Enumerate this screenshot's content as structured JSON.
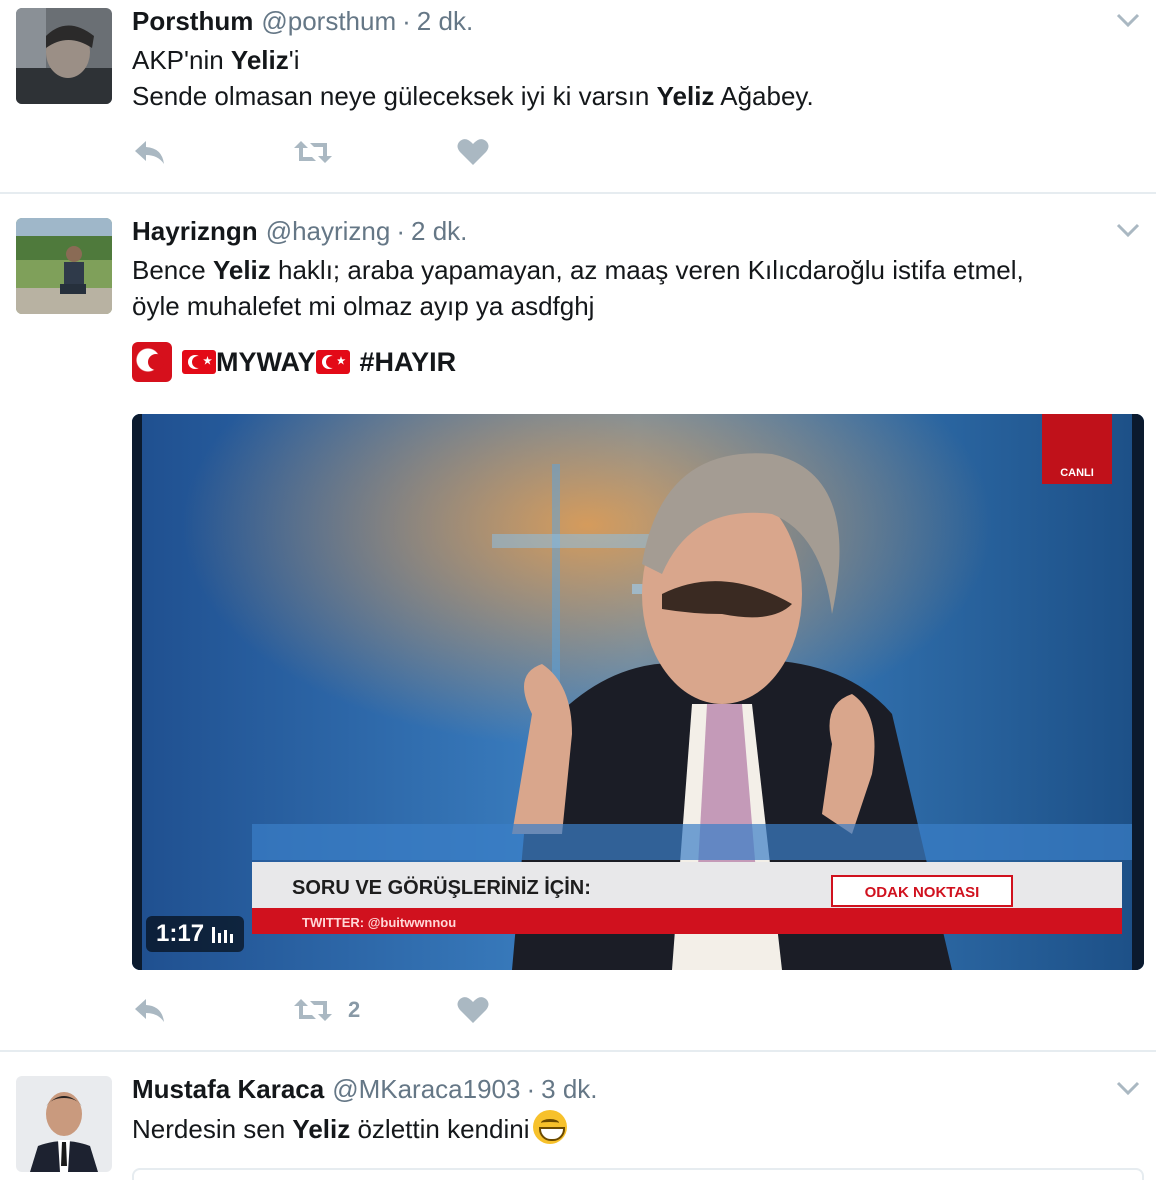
{
  "tweets": [
    {
      "name": "Porsthum",
      "handle": "@porsthum",
      "dot": "·",
      "time": "2 dk.",
      "lines": [
        [
          {
            "t": "AKP'nin "
          },
          {
            "t": "Yeliz",
            "b": true
          },
          {
            "t": "'i"
          }
        ],
        [
          {
            "t": "Sende olmasan neye güleceksek iyi ki varsın "
          },
          {
            "t": "Yeliz",
            "b": true
          },
          {
            "t": " Ağabey."
          }
        ]
      ]
    },
    {
      "name": "Hayrizngn",
      "handle": "@hayrizng",
      "dot": "·",
      "time": "2 dk.",
      "lines": [
        [
          {
            "t": "Bence "
          },
          {
            "t": "Yeliz",
            "b": true
          },
          {
            "t": " haklı; araba yapamayan, az maaş veren Kılıcdaroğlu istifa etmel,"
          }
        ],
        [
          {
            "t": "öyle muhalefet mi olmaz ayıp ya asdfghj"
          }
        ]
      ],
      "tag_line": {
        "myway": "MYWAY",
        "hashtag": "#HAYIR"
      },
      "video": {
        "duration": "1:17",
        "banner_title": "SORU VE GÖRÜŞLERİNİZ İÇİN:",
        "banner_sub": "TWITTER: @buitwwnnou",
        "banner_right": "ODAK NOKTASI",
        "corner": "CANLI"
      },
      "retweet_count": "2"
    },
    {
      "name": "Mustafa Karaca",
      "handle": "@MKaraca1903",
      "dot": "·",
      "time": "3 dk.",
      "lines": [
        [
          {
            "t": "Nerdesin sen "
          },
          {
            "t": "Yeliz",
            "b": true
          },
          {
            "t": " özlettin kendini"
          }
        ]
      ]
    }
  ],
  "icons": {
    "reply": "reply-icon",
    "retweet": "retweet-icon",
    "like": "heart-icon",
    "caret": "chevron-down-icon"
  },
  "colors": {
    "icon_gray": "#aab8c2",
    "name": "#14171a",
    "meta": "#657786",
    "divider": "#e6ecf0"
  }
}
